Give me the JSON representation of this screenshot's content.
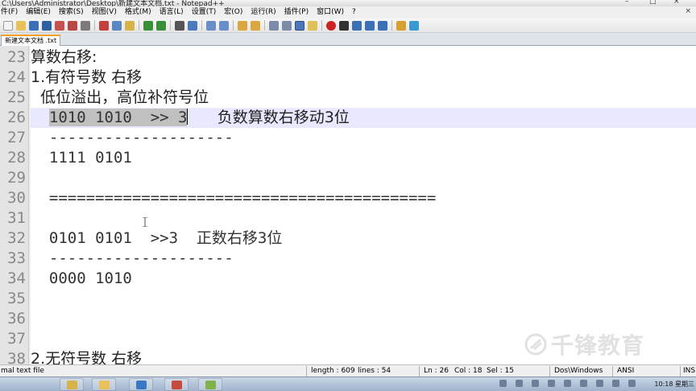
{
  "window": {
    "title": "C:\\Users\\Administrator\\Desktop\\新建文本文档.txt - Notepad++",
    "controls": [
      "–",
      "□",
      "×"
    ]
  },
  "menu": [
    "件(F)",
    "编辑(E)",
    "搜索(S)",
    "视图(V)",
    "格式(M)",
    "语言(L)",
    "设置(T)",
    "宏(O)",
    "运行(R)",
    "插件(P)",
    "窗口(W)",
    "?"
  ],
  "menu_close": "×",
  "tab": {
    "label": "新建文本文档 .txt"
  },
  "editor": {
    "lines": [
      {
        "num": "23",
        "text": "算数右移:",
        "mono": false
      },
      {
        "num": "24",
        "text": "1.有符号数 右移",
        "mono": false
      },
      {
        "num": "25",
        "text": "  低位溢出，高位补符号位",
        "mono": false
      },
      {
        "num": "26",
        "text": "",
        "mono": true,
        "current": true,
        "selected": "1010 1010  >> 3",
        "after": "      负数算数右移动3位"
      },
      {
        "num": "27",
        "text": "  --------------------",
        "mono": true
      },
      {
        "num": "28",
        "text": "  1111 0101",
        "mono": true
      },
      {
        "num": "29",
        "text": "",
        "mono": true
      },
      {
        "num": "30",
        "text": "  ==========================================",
        "mono": true
      },
      {
        "num": "31",
        "text": "",
        "mono": true
      },
      {
        "num": "32",
        "text": "  0101 0101  >>3  正数右移3位",
        "mono": true
      },
      {
        "num": "33",
        "text": "  --------------------",
        "mono": true
      },
      {
        "num": "34",
        "text": "  0000 1010",
        "mono": true
      },
      {
        "num": "35",
        "text": "",
        "mono": true
      },
      {
        "num": "36",
        "text": "",
        "mono": true
      },
      {
        "num": "37",
        "text": "",
        "mono": true
      },
      {
        "num": "38",
        "text": "2.无符号数 右移",
        "mono": false
      }
    ]
  },
  "watermark": {
    "text": "千锋教育"
  },
  "status": {
    "type": "mal text file",
    "length": "length : 609",
    "lines": "lines : 54",
    "ln": "Ln : 26",
    "col": "Col : 18",
    "sel": "Sel : 15",
    "eol": "Dos\\Windows",
    "encoding": "ANSI",
    "mode": "INS"
  },
  "taskbar": {
    "clock": "10:18 星期三",
    "apps": [
      {
        "name": "explorer",
        "color": "#d8b24a"
      },
      {
        "name": "folder",
        "color": "#e8c15a"
      },
      {
        "name": "chart",
        "color": "#3b78c4"
      },
      {
        "name": "browser",
        "color": "#c74b3c"
      },
      {
        "name": "notepad-plus-plus",
        "color": "#7fb24a"
      }
    ]
  },
  "colors": {
    "current_line": "#e8e8ff",
    "selection": "#c0c0c0",
    "gutter": "#e4e4e4",
    "tab_accent": "#f5a020"
  }
}
